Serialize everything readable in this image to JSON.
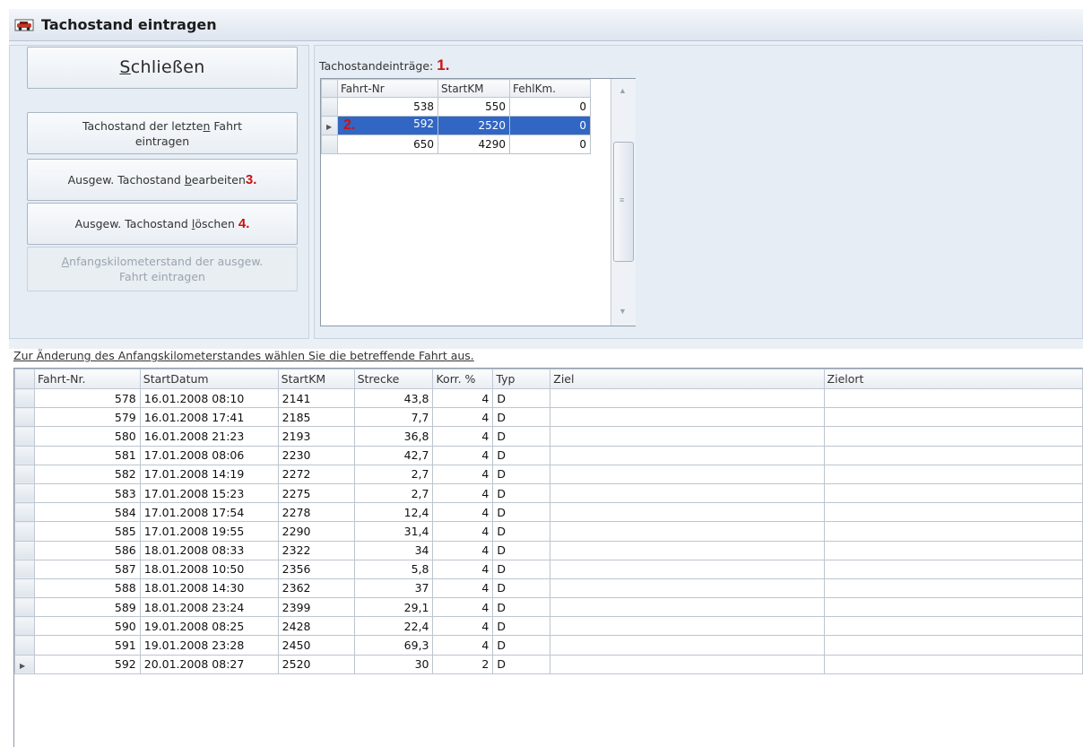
{
  "window": {
    "title": "Tachostand eintragen",
    "icon": "car-icon"
  },
  "buttons": {
    "close_prefix": "S",
    "close_rest": "chließen",
    "last_trip_line1_a": "Tachostand der letzte",
    "last_trip_line1_u": "n",
    "last_trip_line1_b": " Fahrt",
    "last_trip_line2": "eintragen",
    "edit_a": "Ausgew. Tachostand ",
    "edit_u": "b",
    "edit_b": "earbeiten",
    "edit_marker": "3.",
    "delete_a": "Ausgew. Tachostand ",
    "delete_u": "l",
    "delete_b": "öschen",
    "delete_marker": "4.",
    "start_km_u": "A",
    "start_km_line1": "nfangskilometerstand der ausgew.",
    "start_km_line2": "Fahrt eintragen"
  },
  "entries": {
    "label": "Tachostandeinträge:",
    "marker": "1.",
    "row_marker": "2.",
    "columns": [
      "Fahrt-Nr",
      "StartKM",
      "FehlKm."
    ],
    "rows": [
      {
        "fahrt": "538",
        "startkm": "550",
        "fehlkm": "0"
      },
      {
        "fahrt": "592",
        "startkm": "2520",
        "fehlkm": "0"
      },
      {
        "fahrt": "650",
        "startkm": "4290",
        "fehlkm": "0"
      }
    ],
    "selected_index": 1
  },
  "hint": "Zur Änderung des Anfangskilometerstandes wählen Sie die betreffende Fahrt aus.",
  "trips": {
    "columns": [
      "Fahrt-Nr.",
      "StartDatum",
      "StartKM",
      "Strecke",
      "Korr. %",
      "Typ",
      "Ziel",
      "Zielort"
    ],
    "rows": [
      {
        "nr": "578",
        "datum": "16.01.2008 08:10",
        "km": "2141",
        "strecke": "43,8",
        "korr": "4",
        "typ": "D",
        "ziel": "",
        "zielort": ""
      },
      {
        "nr": "579",
        "datum": "16.01.2008 17:41",
        "km": "2185",
        "strecke": "7,7",
        "korr": "4",
        "typ": "D",
        "ziel": "",
        "zielort": ""
      },
      {
        "nr": "580",
        "datum": "16.01.2008 21:23",
        "km": "2193",
        "strecke": "36,8",
        "korr": "4",
        "typ": "D",
        "ziel": "",
        "zielort": ""
      },
      {
        "nr": "581",
        "datum": "17.01.2008 08:06",
        "km": "2230",
        "strecke": "42,7",
        "korr": "4",
        "typ": "D",
        "ziel": "",
        "zielort": ""
      },
      {
        "nr": "582",
        "datum": "17.01.2008 14:19",
        "km": "2272",
        "strecke": "2,7",
        "korr": "4",
        "typ": "D",
        "ziel": "",
        "zielort": ""
      },
      {
        "nr": "583",
        "datum": "17.01.2008 15:23",
        "km": "2275",
        "strecke": "2,7",
        "korr": "4",
        "typ": "D",
        "ziel": "",
        "zielort": ""
      },
      {
        "nr": "584",
        "datum": "17.01.2008 17:54",
        "km": "2278",
        "strecke": "12,4",
        "korr": "4",
        "typ": "D",
        "ziel": "",
        "zielort": ""
      },
      {
        "nr": "585",
        "datum": "17.01.2008 19:55",
        "km": "2290",
        "strecke": "31,4",
        "korr": "4",
        "typ": "D",
        "ziel": "",
        "zielort": ""
      },
      {
        "nr": "586",
        "datum": "18.01.2008 08:33",
        "km": "2322",
        "strecke": "34",
        "korr": "4",
        "typ": "D",
        "ziel": "",
        "zielort": ""
      },
      {
        "nr": "587",
        "datum": "18.01.2008 10:50",
        "km": "2356",
        "strecke": "5,8",
        "korr": "4",
        "typ": "D",
        "ziel": "",
        "zielort": ""
      },
      {
        "nr": "588",
        "datum": "18.01.2008 14:30",
        "km": "2362",
        "strecke": "37",
        "korr": "4",
        "typ": "D",
        "ziel": "",
        "zielort": ""
      },
      {
        "nr": "589",
        "datum": "18.01.2008 23:24",
        "km": "2399",
        "strecke": "29,1",
        "korr": "4",
        "typ": "D",
        "ziel": "",
        "zielort": ""
      },
      {
        "nr": "590",
        "datum": "19.01.2008 08:25",
        "km": "2428",
        "strecke": "22,4",
        "korr": "4",
        "typ": "D",
        "ziel": "",
        "zielort": ""
      },
      {
        "nr": "591",
        "datum": "19.01.2008 23:28",
        "km": "2450",
        "strecke": "69,3",
        "korr": "4",
        "typ": "D",
        "ziel": "",
        "zielort": ""
      },
      {
        "nr": "592",
        "datum": "20.01.2008 08:27",
        "km": "2520",
        "strecke": "30",
        "korr": "2",
        "typ": "D",
        "ziel": "",
        "zielort": ""
      }
    ],
    "current_index": 14
  },
  "colors": {
    "selection": "#3166c4",
    "marker": "#cc1111",
    "panel": "#e6edf5"
  }
}
